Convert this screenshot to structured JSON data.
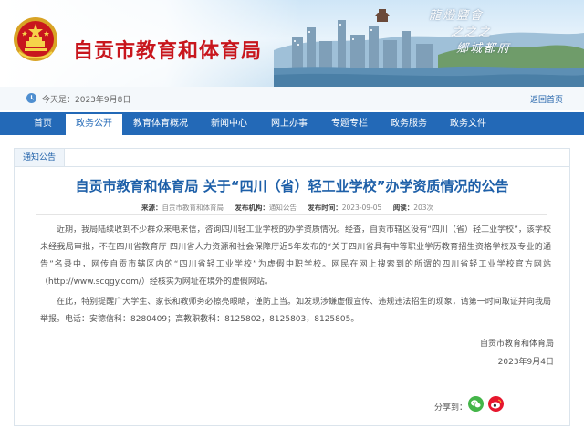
{
  "header": {
    "site_title": "自贡市教育和体育局",
    "slogan_lines": [
      "龍燈鹽會",
      "之之之",
      "鄉城都府"
    ]
  },
  "datebar": {
    "today": "今天是：2023年9月8日",
    "home_link": "返回首页"
  },
  "nav": {
    "items": [
      "首页",
      "政务公开",
      "教育体育概况",
      "新闻中心",
      "网上办事",
      "专题专栏",
      "政务服务",
      "政务文件"
    ],
    "active_index": 1
  },
  "article": {
    "tab_label": "通知公告",
    "title": "自贡市教育和体育局 关于“四川（省）轻工业学校”办学资质情况的公告",
    "meta": {
      "source_key": "来源：",
      "source_val": "自贡市教育和体育局",
      "author_key": "发布机构：",
      "author_val": "通知公告",
      "date_key": "发布时间：",
      "date_val": "2023-09-05",
      "views_key": "阅读：",
      "views_val": "203次"
    },
    "paragraph1": "近期，我局陆续收到不少群众来电来信，咨询四川轻工业学校的办学资质情况。经查，自贡市辖区没有“四川（省）轻工业学校”，该学校未经我局审批，不在四川省教育厅 四川省人力资源和社会保障厅近5年发布的“关于四川省具有中等职业学历教育招生资格学校及专业的通告”名录中，网传自贡市辖区内的“四川省轻工业学校”为虚假中职学校。网民在网上搜索到的所谓的四川省轻工业学校官方网站（http://www.scqgy.com/）经核实为网址在境外的虚假网站。",
    "paragraph2": "在此，特别提醒广大学生、家长和教师务必擦亮眼睛，谨防上当。如发现涉嫌虚假宣传、违规违法招生的现象，请第一时间取证并向我局举报。电话：安德信科：8280409；高教职教科：8125802，8125803，8125805。",
    "sign_org": "自贡市教育和体育局",
    "sign_date": "2023年9月4日",
    "share_label": "分享到："
  },
  "colors": {
    "brand_red": "#c8161d",
    "nav_blue": "#2369b7",
    "title_blue": "#1d5fa8"
  }
}
